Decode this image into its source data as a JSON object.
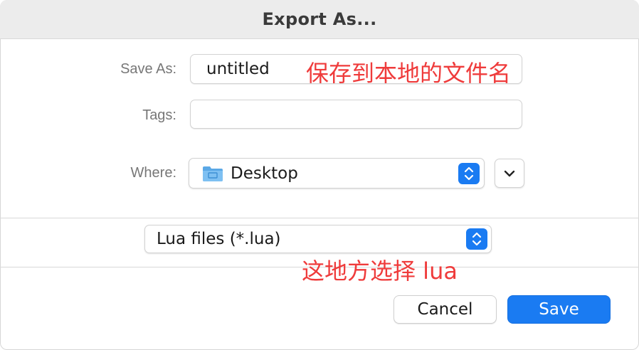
{
  "dialog": {
    "title": "Export As..."
  },
  "form": {
    "save_as_label": "Save As:",
    "save_as_value": "untitled",
    "tags_label": "Tags:",
    "tags_value": "",
    "where_label": "Where:",
    "where_value": "Desktop",
    "where_icon": "folder-icon",
    "expand_icon": "chevron-down-icon"
  },
  "format": {
    "selected": "Lua files (*.lua)"
  },
  "buttons": {
    "cancel": "Cancel",
    "save": "Save"
  },
  "annotations": {
    "filename_note": "保存到本地的文件名",
    "format_note": "这地方选择 lua"
  },
  "colors": {
    "accent": "#1a7bf2",
    "annotation": "#ef3b3b"
  }
}
